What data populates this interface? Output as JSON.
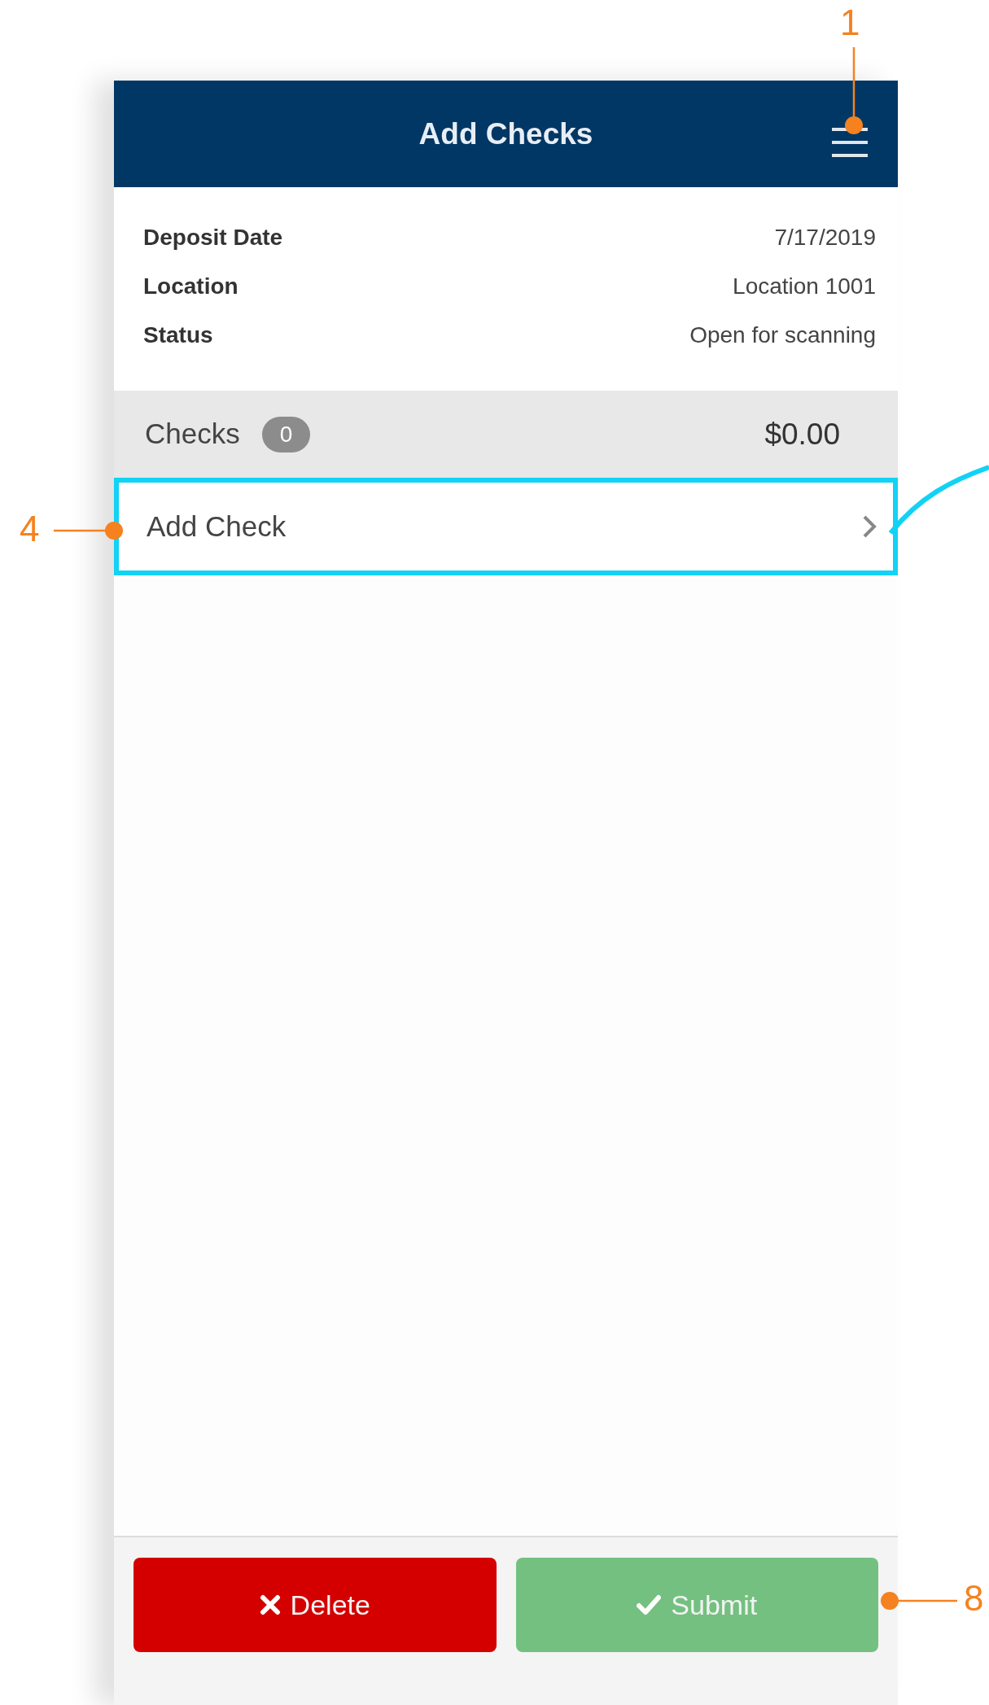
{
  "header": {
    "title": "Add Checks"
  },
  "deposit_info": [
    {
      "label": "Deposit Date",
      "value": "7/17/2019"
    },
    {
      "label": "Location",
      "value": "Location 1001"
    },
    {
      "label": "Status",
      "value": "Open for scanning"
    }
  ],
  "checks_summary": {
    "label": "Checks",
    "count": "0",
    "total": "$0.00"
  },
  "add_check": {
    "label": "Add Check",
    "highlighted": true
  },
  "actions": [
    {
      "kind": "delete",
      "label": "Delete"
    },
    {
      "kind": "submit",
      "label": "Submit"
    }
  ],
  "callouts": [
    {
      "number": "1"
    },
    {
      "number": "4"
    },
    {
      "number": "8"
    }
  ]
}
